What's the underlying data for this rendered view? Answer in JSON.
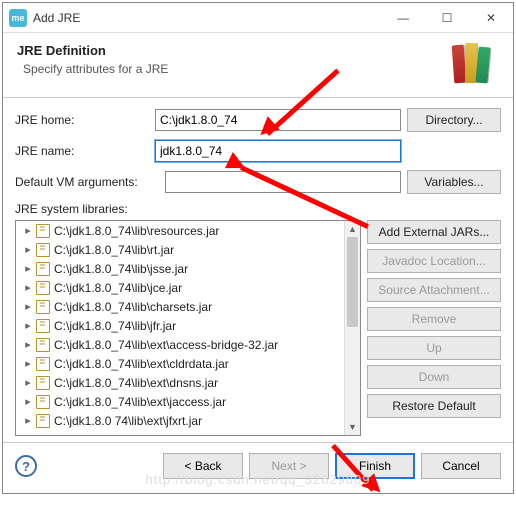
{
  "window": {
    "title": "Add JRE",
    "icon_label": "me"
  },
  "header": {
    "title": "JRE Definition",
    "subtitle": "Specify attributes for a JRE"
  },
  "fields": {
    "jre_home_label": "JRE home:",
    "jre_home_value": "C:\\jdk1.8.0_74",
    "directory_btn": "Directory...",
    "jre_name_label": "JRE name:",
    "jre_name_value": "jdk1.8.0_74",
    "vm_args_label": "Default VM arguments:",
    "vm_args_value": "",
    "variables_btn": "Variables...",
    "libs_label": "JRE system libraries:"
  },
  "libs": [
    "C:\\jdk1.8.0_74\\lib\\resources.jar",
    "C:\\jdk1.8.0_74\\lib\\rt.jar",
    "C:\\jdk1.8.0_74\\lib\\jsse.jar",
    "C:\\jdk1.8.0_74\\lib\\jce.jar",
    "C:\\jdk1.8.0_74\\lib\\charsets.jar",
    "C:\\jdk1.8.0_74\\lib\\jfr.jar",
    "C:\\jdk1.8.0_74\\lib\\ext\\access-bridge-32.jar",
    "C:\\jdk1.8.0_74\\lib\\ext\\cldrdata.jar",
    "C:\\jdk1.8.0_74\\lib\\ext\\dnsns.jar",
    "C:\\jdk1.8.0_74\\lib\\ext\\jaccess.jar",
    "C:\\jdk1.8.0 74\\lib\\ext\\jfxrt.jar"
  ],
  "lib_buttons": {
    "add_external": "Add External JARs...",
    "javadoc": "Javadoc Location...",
    "source": "Source Attachment...",
    "remove": "Remove",
    "up": "Up",
    "down": "Down",
    "restore": "Restore Default"
  },
  "footer": {
    "back": "< Back",
    "next": "Next >",
    "finish": "Finish",
    "cancel": "Cancel"
  },
  "watermark": "http://blog.csdn.net/qq_32629809"
}
